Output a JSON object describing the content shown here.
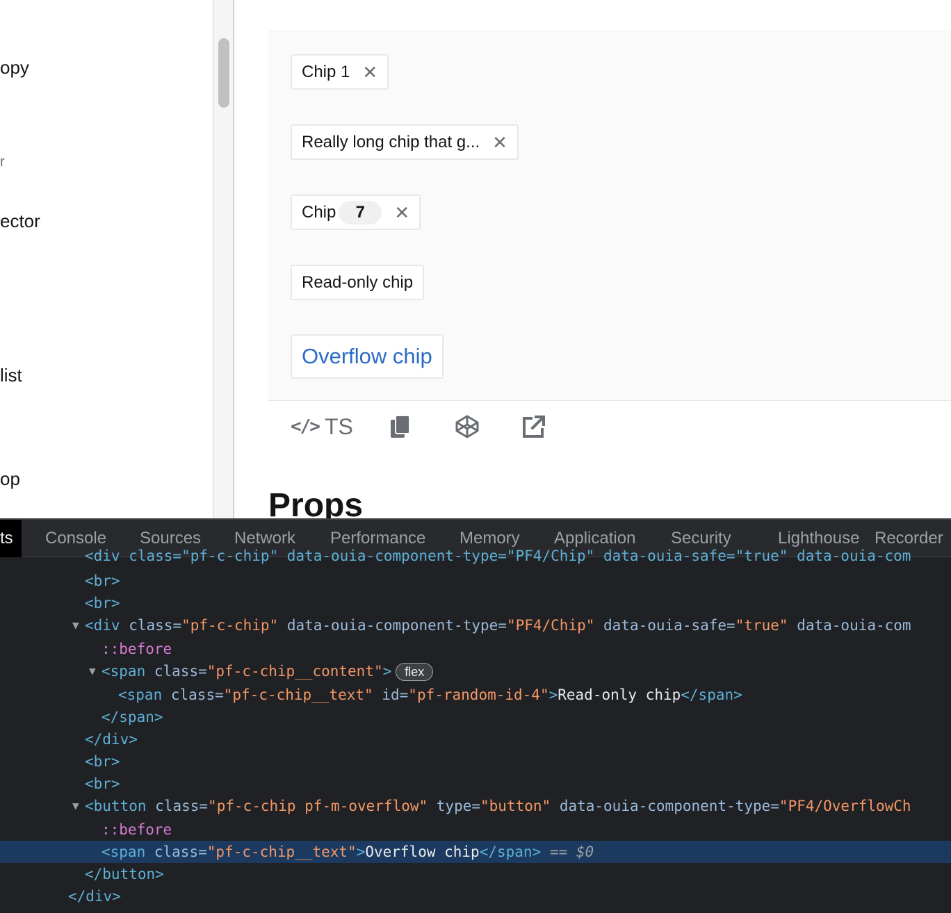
{
  "sidebar": {
    "items": [
      {
        "label": "opy"
      },
      {
        "label": "r"
      },
      {
        "label": "ector"
      },
      {
        "label": " list"
      },
      {
        "label": "op"
      }
    ]
  },
  "example": {
    "chips": [
      {
        "label": "Chip 1"
      },
      {
        "label": "Really long chip that g..."
      },
      {
        "label": "Chip",
        "badge": "7"
      },
      {
        "label": "Read-only chip"
      },
      {
        "label": "Overflow chip"
      }
    ],
    "toolbar": {
      "ts_glyph": "</>",
      "ts_label": "TS"
    }
  },
  "props_title": "Props",
  "devtools": {
    "tabs": [
      "ts",
      "Console",
      "Sources",
      "Network",
      "Performance",
      "Memory",
      "Application",
      "Security",
      "Lighthouse",
      "Recorder"
    ],
    "code": {
      "l0": "<div class=\"pf-c-chip\" data-ouia-component-type=\"PF4/Chip\" data-ouia-safe=\"true\" data-ouia-com",
      "br": "<br>",
      "div_open": "<div",
      "attr_class": "class",
      "val_chip": "\"pf-c-chip\"",
      "attr_type": "data-ouia-component-type",
      "val_type_chip": "\"PF4/Chip\"",
      "attr_safe": "data-ouia-safe",
      "val_true": "\"true\"",
      "attr_com": "data-ouia-com",
      "before": "::before",
      "span_open": "<span",
      "val_content": "\"pf-c-chip__content\"",
      "gt": ">",
      "flex": "flex",
      "val_text": "\"pf-c-chip__text\"",
      "attr_id": "id",
      "val_id": "\"pf-random-id-4\"",
      "readonly_text": "Read-only chip",
      "span_close": "</span>",
      "div_close": "</div>",
      "button_open": "<button",
      "val_overflow": "\"pf-c-chip pf-m-overflow\"",
      "attr_btype": "type",
      "val_button": "\"button\"",
      "val_type_overflow": "\"PF4/OverflowCh",
      "overflow_text": "Overflow chip",
      "eq_dollar": "==",
      "dollar0": "$0",
      "button_close": "</button>"
    }
  }
}
